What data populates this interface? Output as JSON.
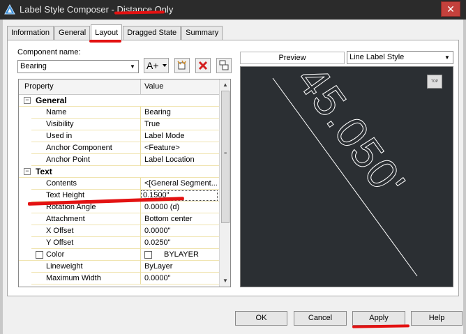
{
  "window": {
    "title": "Label Style Composer - Distance Only",
    "close_glyph": "✕"
  },
  "tabs": [
    "Information",
    "General",
    "Layout",
    "Dragged State",
    "Summary"
  ],
  "component": {
    "label": "Component name:",
    "value": "Bearing"
  },
  "toolbar": {
    "add_label": "A+"
  },
  "grid": {
    "col_property": "Property",
    "col_value": "Value",
    "rows": [
      {
        "type": "cat",
        "label": "General",
        "expander": "−"
      },
      {
        "label": "Name",
        "value": "Bearing"
      },
      {
        "label": "Visibility",
        "value": "True"
      },
      {
        "label": "Used in",
        "value": "Label Mode"
      },
      {
        "label": "Anchor Component",
        "value": "<Feature>"
      },
      {
        "label": "Anchor Point",
        "value": "Label Location"
      },
      {
        "type": "cat",
        "label": "Text",
        "expander": "−"
      },
      {
        "label": "Contents",
        "value": "<[General Segment..."
      },
      {
        "label": "Text Height",
        "value": "0.1500\"",
        "selected": true
      },
      {
        "label": "Rotation Angle",
        "value": "0.0000 (d)"
      },
      {
        "label": "Attachment",
        "value": "Bottom center"
      },
      {
        "label": "X Offset",
        "value": "0.0000\""
      },
      {
        "label": "Y Offset",
        "value": "0.0250\""
      },
      {
        "label": "Color",
        "value": "BYLAYER",
        "checkbox": true
      },
      {
        "label": "Lineweight",
        "value": "ByLayer"
      },
      {
        "label": "Maximum Width",
        "value": "0.0000\""
      }
    ]
  },
  "preview": {
    "label": "Preview",
    "style_select": "Line Label Style",
    "view_button": "TOP",
    "label_text": "45.050'",
    "line_color": "#ffffff",
    "bg_color": "#2b2f33"
  },
  "buttons": {
    "ok": "OK",
    "cancel": "Cancel",
    "apply": "Apply",
    "help": "Help"
  },
  "annotation_color": "#e31212"
}
